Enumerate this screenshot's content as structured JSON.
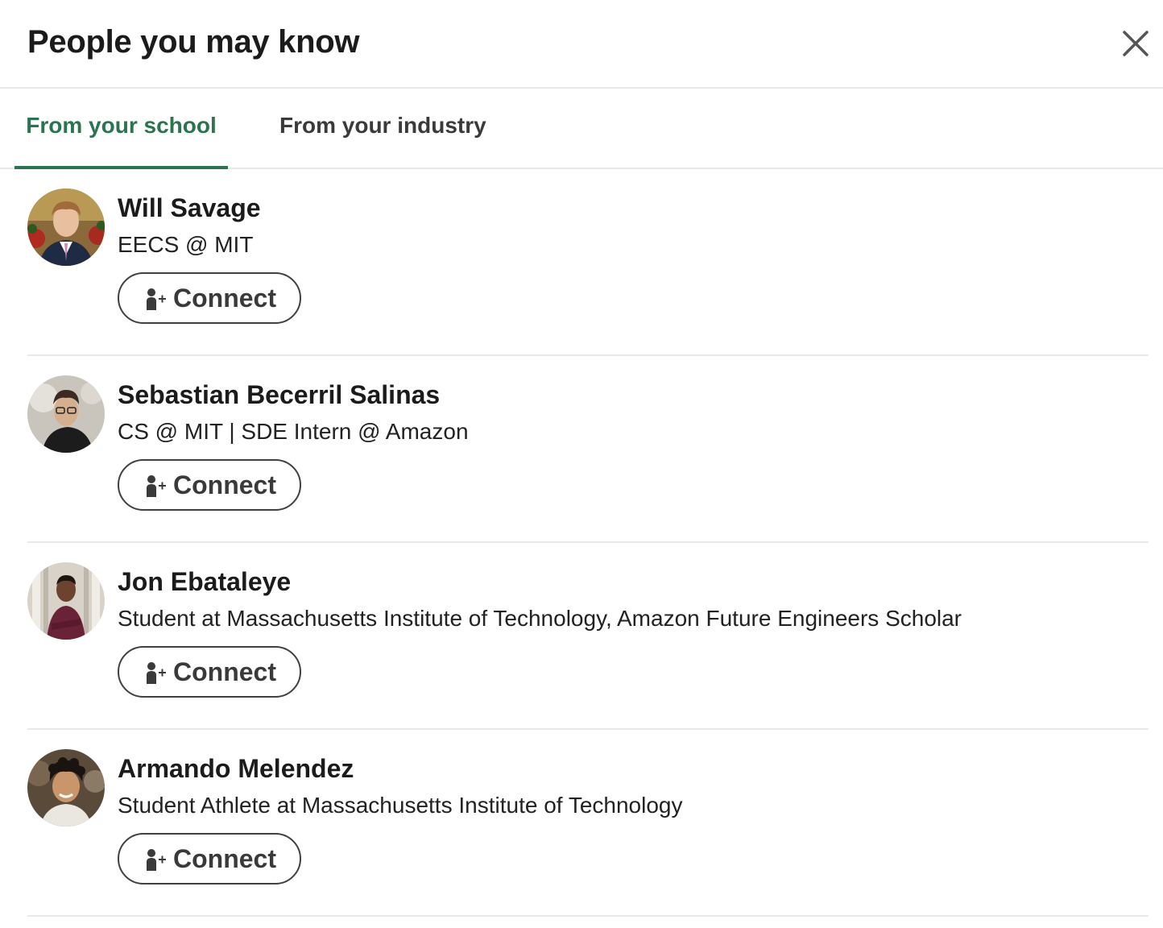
{
  "header": {
    "title": "People you may know",
    "close_icon": "close-icon"
  },
  "tabs": [
    {
      "label": "From your school",
      "selected": true
    },
    {
      "label": "From your industry",
      "selected": false
    }
  ],
  "colors": {
    "accent": "#2c7350",
    "divider": "#e8e8e8",
    "button_border": "#404040"
  },
  "people": [
    {
      "name": "Will Savage",
      "headline": "EECS @ MIT",
      "connect_label": "Connect",
      "connect_icon": "add-person-icon"
    },
    {
      "name": "Sebastian Becerril Salinas",
      "headline": "CS @ MIT | SDE Intern @ Amazon",
      "connect_label": "Connect",
      "connect_icon": "add-person-icon"
    },
    {
      "name": "Jon Ebataleye",
      "headline": "Student at Massachusetts Institute of Technology, Amazon Future Engineers Scholar",
      "connect_label": "Connect",
      "connect_icon": "add-person-icon"
    },
    {
      "name": "Armando Melendez",
      "headline": "Student Athlete at Massachusetts Institute of Technology",
      "connect_label": "Connect",
      "connect_icon": "add-person-icon"
    }
  ]
}
